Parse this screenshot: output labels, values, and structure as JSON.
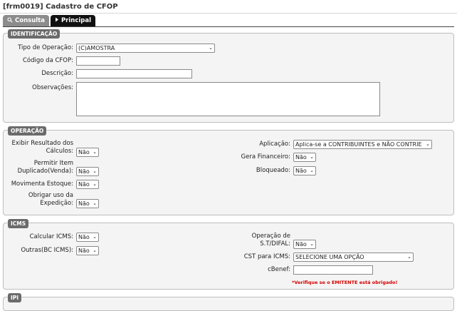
{
  "window_title": "[frm0019] Cadastro de CFOP",
  "tabs": {
    "consulta": "Consulta",
    "principal": "Principal"
  },
  "identificacao": {
    "legend": "IDENTIFICAÇÃO",
    "tipo_operacao_label": "Tipo de Operação:",
    "tipo_operacao_value": "(C)AMOSTRA",
    "codigo_label": "Código da CFOP:",
    "codigo_value": "",
    "descricao_label": "Descrição:",
    "descricao_value": "",
    "observacoes_label": "Observações:",
    "observacoes_value": ""
  },
  "operacao": {
    "legend": "OPERAÇÃO",
    "exibir_label_1": "Exibir Resultado dos",
    "exibir_label_2": "Cálculos:",
    "exibir_value": "Não",
    "permitir_label_1": "Permitir Item",
    "permitir_label_2": "Duplicado(Venda):",
    "permitir_value": "Não",
    "movimenta_label": "Movimenta Estoque:",
    "movimenta_value": "Não",
    "obrigar_label_1": "Obrigar uso da",
    "obrigar_label_2": "Expedição:",
    "obrigar_value": "Não",
    "aplicacao_label": "Aplicação:",
    "aplicacao_value": "Aplica-se a CONTRIBUINTES e NÃO CONTRIE",
    "gera_label": "Gera Financeiro:",
    "gera_value": "Não",
    "bloqueado_label": "Bloqueado:",
    "bloqueado_value": "Não"
  },
  "icms": {
    "legend": "ICMS",
    "calcular_label": "Calcular ICMS:",
    "calcular_value": "Não",
    "outras_label": "Outras(BC ICMS):",
    "outras_value": "Não",
    "st_label_1": "Operação de",
    "st_label_2": "S.T/DIFAL:",
    "st_value": "Não",
    "cst_label": "CST para ICMS:",
    "cst_value": "SELECIONE UMA OPÇÃO",
    "cbenef_label": "cBenef:",
    "cbenef_value": "",
    "warning": "*Verifique se o EMITENTE está obrigado!"
  },
  "ipi": {
    "legend": "IPI"
  }
}
